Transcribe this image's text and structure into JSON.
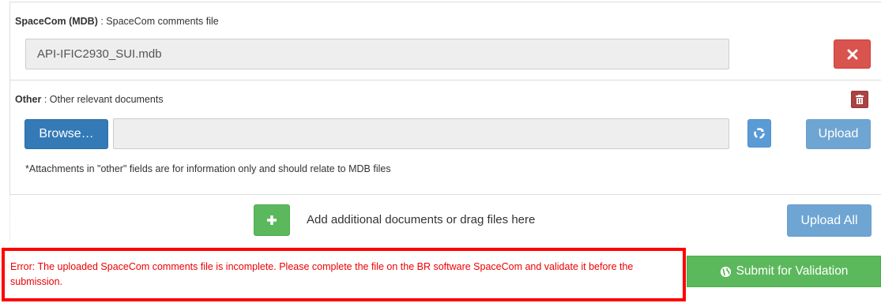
{
  "spacecom": {
    "title": "SpaceCom (MDB)",
    "description": " : SpaceCom comments file",
    "filename": "API-IFIC2930_SUI.mdb"
  },
  "other": {
    "title": "Other",
    "description": " : Other relevant documents",
    "browse_label": "Browse…",
    "file_value": "",
    "upload_label": "Upload",
    "note": "*Attachments in \"other\" fields are for information only and should relate to MDB files"
  },
  "add_documents": {
    "label": "Add additional documents or drag files here",
    "upload_all_label": "Upload All"
  },
  "error": {
    "message": "Error: The uploaded SpaceCom comments file is incomplete. Please complete the file on the BR software SpaceCom and validate it before the submission."
  },
  "submit": {
    "label": "Submit for Validation"
  },
  "colors": {
    "danger": "#d9534f",
    "primary": "#337ab7",
    "success": "#5cb85c",
    "error_text": "#ee0000",
    "error_border": "#ff0000"
  },
  "icons": [
    "close-icon",
    "trash-icon",
    "recycle-icon",
    "plus-icon",
    "globe-icon"
  ]
}
